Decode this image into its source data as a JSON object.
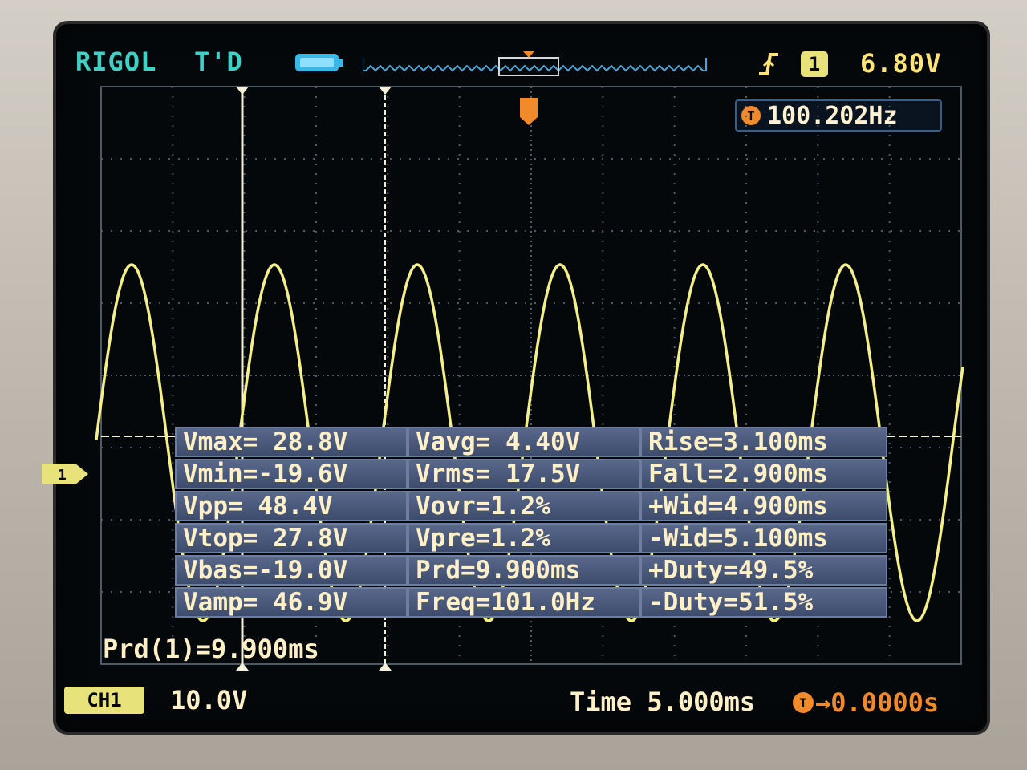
{
  "header": {
    "brand": "RIGOL",
    "trigger_status": "T'D",
    "trigger_edge_icon": "rising-edge-icon",
    "trigger_source": "1",
    "trigger_level": "6.80V"
  },
  "counter": {
    "icon": "T",
    "value": "100.202Hz"
  },
  "measurements": [
    [
      "Vmax= 28.8V",
      "Vavg= 4.40V",
      "Rise=3.100ms"
    ],
    [
      "Vmin=-19.6V",
      "Vrms= 17.5V",
      "Fall=2.900ms"
    ],
    [
      "Vpp= 48.4V",
      "Vovr=1.2%",
      "+Wid=4.900ms"
    ],
    [
      "Vtop= 27.8V",
      "Vpre=1.2%",
      "-Wid=5.100ms"
    ],
    [
      "Vbas=-19.0V",
      "Prd=9.900ms",
      "+Duty=49.5%"
    ],
    [
      "Vamp= 46.9V",
      "Freq=101.0Hz",
      "-Duty=51.5%"
    ]
  ],
  "cursor_readout": "Prd(1)=9.900ms",
  "footer": {
    "channel_badge": "CH1",
    "channel_scale": "10.0V",
    "time_label": "Time 5.000ms",
    "trigger_offset_icon": "T",
    "trigger_offset": "→0.0000s"
  },
  "channel_marker": "1",
  "colors": {
    "trace": "#f3ef8a",
    "grid": "#4e5a66",
    "cursor": "#f4f2da",
    "accent_teal": "#3fd1c6",
    "trigger_orange": "#f08a2a"
  }
}
